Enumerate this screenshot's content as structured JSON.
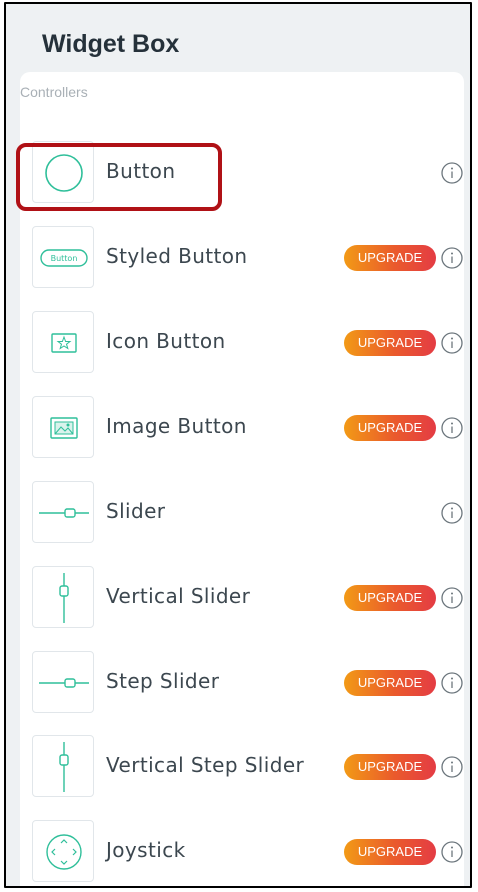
{
  "header": {
    "title": "Widget Box"
  },
  "section": {
    "label": "Controllers"
  },
  "widgets": [
    {
      "label": "Button",
      "badge": "",
      "icon": "circle-button-icon"
    },
    {
      "label": "Styled Button",
      "badge": "UPGRADE",
      "icon": "styled-button-icon"
    },
    {
      "label": "Icon Button",
      "badge": "UPGRADE",
      "icon": "icon-button-icon"
    },
    {
      "label": "Image Button",
      "badge": "UPGRADE",
      "icon": "image-button-icon"
    },
    {
      "label": "Slider",
      "badge": "",
      "icon": "slider-icon"
    },
    {
      "label": "Vertical Slider",
      "badge": "UPGRADE",
      "icon": "vertical-slider-icon"
    },
    {
      "label": "Step Slider",
      "badge": "UPGRADE",
      "icon": "step-slider-icon"
    },
    {
      "label": "Vertical Step Slider",
      "badge": "UPGRADE",
      "icon": "vertical-step-slider-icon"
    },
    {
      "label": "Joystick",
      "badge": "UPGRADE",
      "icon": "joystick-icon"
    }
  ],
  "thumb_text": {
    "styled_button": "Button"
  },
  "colors": {
    "accent": "#2fbf9a",
    "highlight": "#b01116",
    "badge_start": "#f29a16",
    "badge_end": "#e43c44"
  }
}
